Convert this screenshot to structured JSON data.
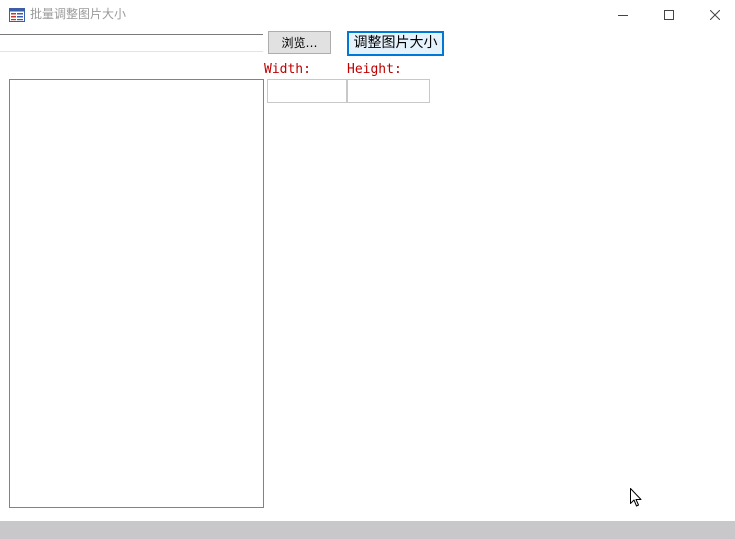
{
  "window": {
    "title": "批量调整图片大小",
    "icon": "form-window-icon",
    "controls": [
      "minimize-icon",
      "maximize-icon",
      "close-icon"
    ]
  },
  "toolbar": {
    "path_value": "",
    "browse_label": "浏览…",
    "resize_label": "调整图片大小"
  },
  "size": {
    "width_label": "Width:",
    "height_label": "Height:",
    "width_value": "",
    "height_value": ""
  },
  "file_list": {
    "items": []
  },
  "colors": {
    "label": "#c00000",
    "focus_border": "#0078d7",
    "status_bar": "#c8c8cb"
  }
}
